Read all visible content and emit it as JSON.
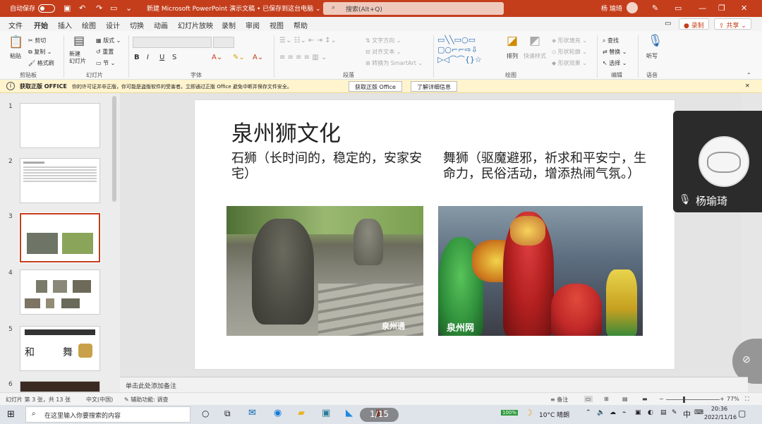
{
  "titlebar": {
    "autosave_label": "自动保存",
    "autosave_state": "关",
    "doc_title": "新建 Microsoft PowerPoint 演示文稿 • 已保存到这台电脑 ⌄",
    "search_placeholder": "搜索(Alt+Q)",
    "user_name": "杨 瑜琦"
  },
  "tabs": [
    "文件",
    "开始",
    "插入",
    "绘图",
    "设计",
    "切换",
    "动画",
    "幻灯片放映",
    "录制",
    "审阅",
    "视图",
    "帮助"
  ],
  "active_tab": "开始",
  "tab_right": {
    "record": "录制",
    "share": "共享"
  },
  "ribbon": {
    "clipboard": {
      "paste": "粘贴",
      "cut": "剪切",
      "copy": "复制",
      "format_painter": "格式刷",
      "group": "剪贴板"
    },
    "slides": {
      "new_slide": "新建\n幻灯片",
      "layout": "版式",
      "reset": "重置",
      "section": "节",
      "group": "幻灯片"
    },
    "font": {
      "bold": "B",
      "italic": "I",
      "underline": "U",
      "strike": "S",
      "group": "字体"
    },
    "paragraph": {
      "text_direction": "文字方向",
      "align_text": "对齐文本",
      "smartart": "转换为 SmartArt",
      "group": "段落"
    },
    "drawing": {
      "arrange": "排列",
      "quick_styles": "快速样式",
      "fill": "形状填充",
      "outline": "形状轮廓",
      "effects": "形状效果",
      "group": "绘图"
    },
    "editing": {
      "find": "查找",
      "replace": "替换",
      "select": "选择",
      "group": "编辑"
    },
    "voice": {
      "dictate": "听写",
      "group": "语音"
    }
  },
  "infobar": {
    "title": "获取正版 OFFICE",
    "message": "你的许可证并非正版，你可能是盗版软件的受害者。立即通过正版 Office 避免中断并保存文件安全。",
    "btn_genuine": "获取正版 Office",
    "btn_details": "了解详细信息"
  },
  "thumbnails": {
    "numbers": [
      "1",
      "2",
      "3",
      "4",
      "5",
      "6"
    ],
    "selected": "3"
  },
  "slide": {
    "title": "泉州狮文化",
    "left_text": "石狮（长时间的，稳定的，安家安宅）",
    "right_text": "舞狮（驱魔避邪，祈求和平安宁，生命力，民俗活动，增添热闹气氛。）",
    "watermark_left": "泉州通",
    "watermark_right": "泉州网"
  },
  "meeting": {
    "participant": "杨瑜琦"
  },
  "notes_placeholder": "单击此处添加备注",
  "statusbar": {
    "slide_info": "幻灯片 第 3 张，共 13 张",
    "language": "中文(中国)",
    "accessibility": "辅助功能: 调查",
    "notes": "备注",
    "zoom": "77%"
  },
  "taskbar": {
    "search_placeholder": "在这里输入你要搜索的内容",
    "page_indicator": "1/15",
    "battery": "100%",
    "weather": "10°C 晴朗",
    "ime": "中",
    "time": "20:36",
    "date": "2022/11/16"
  },
  "colors": {
    "accent": "#c43e1c",
    "infobar": "#fff4ce"
  }
}
